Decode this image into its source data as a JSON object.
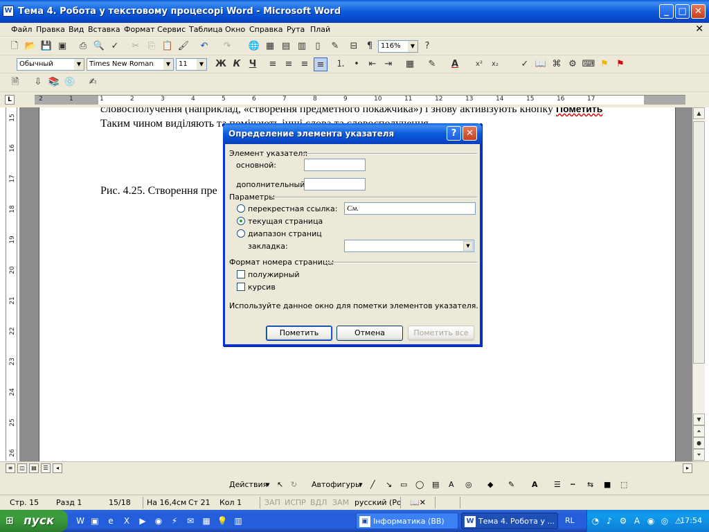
{
  "window": {
    "title": "Тема 4. Робота у текстовому процесорі Word - Microsoft Word",
    "app_icon": "word-icon"
  },
  "menu": [
    "Файл",
    "Правка",
    "Вид",
    "Вставка",
    "Формат",
    "Сервис",
    "Таблица",
    "Окно",
    "Справка",
    "Рута",
    "Плай"
  ],
  "standard_toolbar": {
    "zoom": "116%"
  },
  "format_toolbar": {
    "style": "Обычный",
    "font": "Times New Roman",
    "size": "11",
    "bold": "Ж",
    "italic": "К",
    "underline": "Ч"
  },
  "ruler": {
    "h_numbers": [
      "2",
      "1",
      "1",
      "2",
      "3",
      "4",
      "5",
      "6",
      "7",
      "8",
      "9",
      "10",
      "11",
      "12",
      "13",
      "14",
      "15",
      "16",
      "17"
    ],
    "v_numbers": [
      "15",
      "16",
      "17",
      "18",
      "19",
      "20",
      "21",
      "22",
      "23",
      "24",
      "25",
      "26"
    ]
  },
  "document": {
    "line1": "словосполучення (наприклад, «створення предметного покажчика») і знову активізують кнопку",
    "line1_bold": "Пометить",
    "line2": "Таким чином виділяють та помічають інші слова та словосполучення.",
    "caption": "Рис. 4.25. Створення пре"
  },
  "dialog": {
    "title": "Определение элемента указателя",
    "group_entry": "Элемент указателя",
    "main_label": "основной:",
    "main_value": "",
    "sub_label": "дополнительный:",
    "sub_value": "",
    "group_params": "Параметры",
    "cross_ref_label": "перекрестная ссылка:",
    "cross_ref_value": "См.",
    "current_page_label": "текущая страница",
    "page_range_label": "диапазон страниц",
    "bookmark_label": "закладка:",
    "bookmark_value": "",
    "selected_option": "current_page",
    "group_format": "Формат номера страницы",
    "bold_label": "полужирный",
    "italic_label": "курсив",
    "bold_checked": false,
    "italic_checked": false,
    "hint": "Используйте данное окно для пометки элементов указателя.",
    "btn_mark": "Пометить",
    "btn_cancel": "Отмена",
    "btn_mark_all": "Пометить все"
  },
  "drawing_toolbar": {
    "actions": "Действия",
    "autoshapes": "Автофигуры"
  },
  "status": {
    "page": "Стр. 15",
    "section": "Разд 1",
    "pages": "15/18",
    "at": "На 16,4см",
    "line": "Ст 21",
    "col": "Кол 1",
    "rec": "ЗАП",
    "trk": "ИСПР",
    "ext": "ВДЛ",
    "ovr": "ЗАМ",
    "lang": "русский (Ро"
  },
  "taskbar": {
    "start": "пуск",
    "tasks": [
      {
        "label": "Інформатика (ВВ)"
      },
      {
        "label": "Тема 4. Робота у ..."
      }
    ],
    "lang": "RL",
    "clock": "17:54"
  }
}
